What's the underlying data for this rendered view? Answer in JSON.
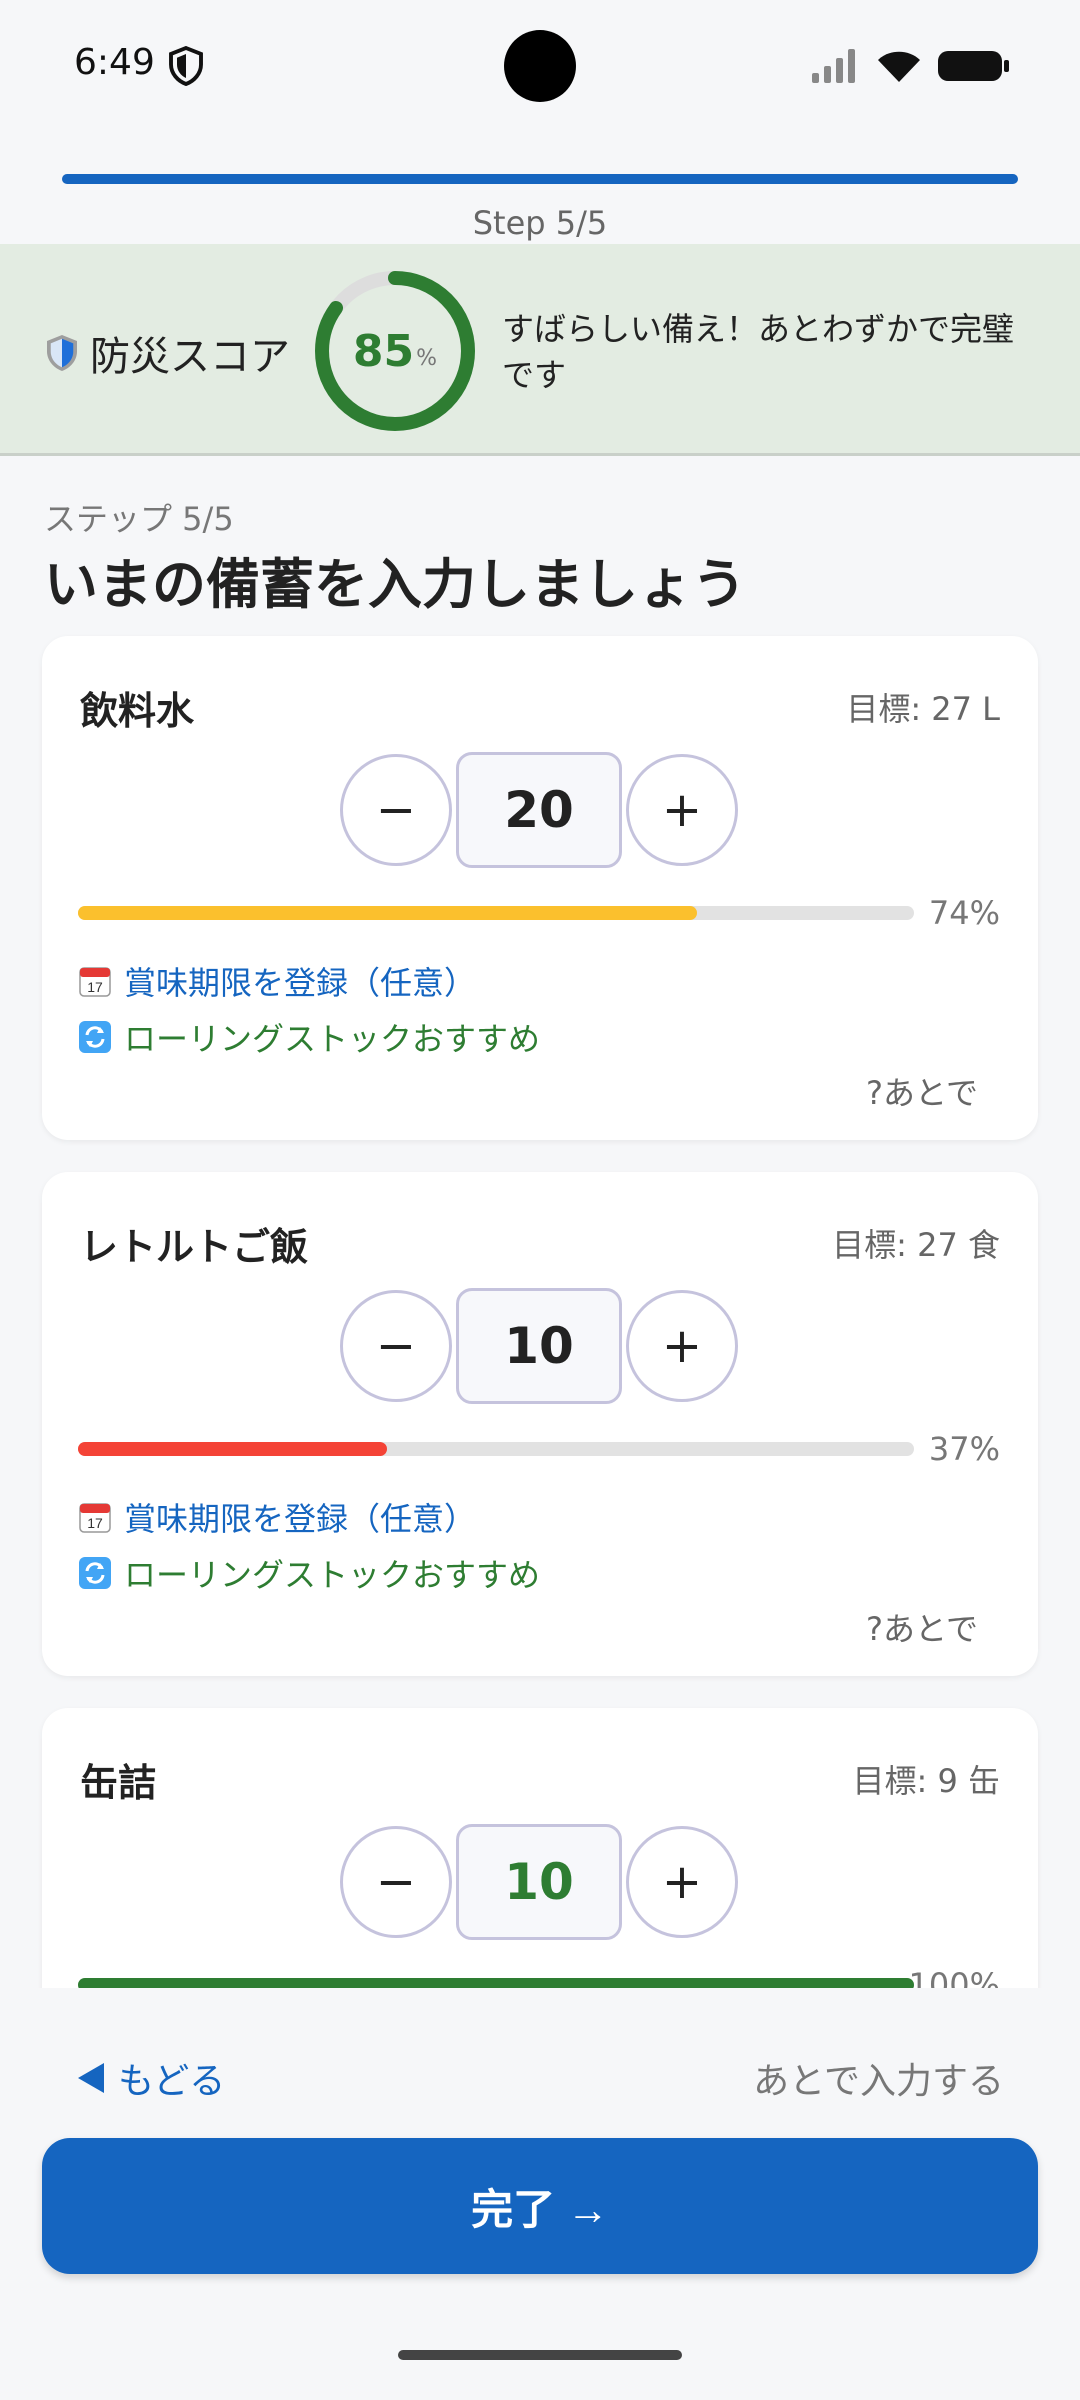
{
  "status": {
    "time": "6:49"
  },
  "progress": {
    "fraction": 1.0,
    "step_label": "Step 5/5"
  },
  "score": {
    "label": "防災スコア",
    "value": "85",
    "percent_sign": "%",
    "fraction": 0.85,
    "message": "すばらしい備え！あとわずかで完璧です",
    "color": "#2e7d32"
  },
  "section": {
    "subtitle": "ステップ 5/5",
    "title": "いまの備蓄を入力しましょう"
  },
  "items": [
    {
      "name": "飲料水",
      "target": "目標: 27 L",
      "minus": "−",
      "value": "20",
      "plus": "+",
      "percent": "74%",
      "fraction": 0.74,
      "bar_color": "#fbc02d",
      "value_color": "#222222",
      "expiry_link": "賞味期限を登録（任意）",
      "rolling_link": "ローリングストックおすすめ",
      "later": "?あとで"
    },
    {
      "name": "レトルトご飯",
      "target": "目標: 27 食",
      "minus": "−",
      "value": "10",
      "plus": "+",
      "percent": "37%",
      "fraction": 0.37,
      "bar_color": "#f44336",
      "value_color": "#222222",
      "expiry_link": "賞味期限を登録（任意）",
      "rolling_link": "ローリングストックおすすめ",
      "later": "?あとで"
    },
    {
      "name": "缶詰",
      "target": "目標: 9 缶",
      "minus": "−",
      "value": "10",
      "plus": "+",
      "percent": "100%",
      "fraction": 1.0,
      "bar_color": "#2e7d32",
      "value_color": "#2e7d32"
    }
  ],
  "nav": {
    "back": "もどる",
    "later_input": "あとで入力する",
    "done": "完了 →"
  },
  "colors": {
    "accent": "#1565c0",
    "banner_bg": "#e3ece2"
  }
}
